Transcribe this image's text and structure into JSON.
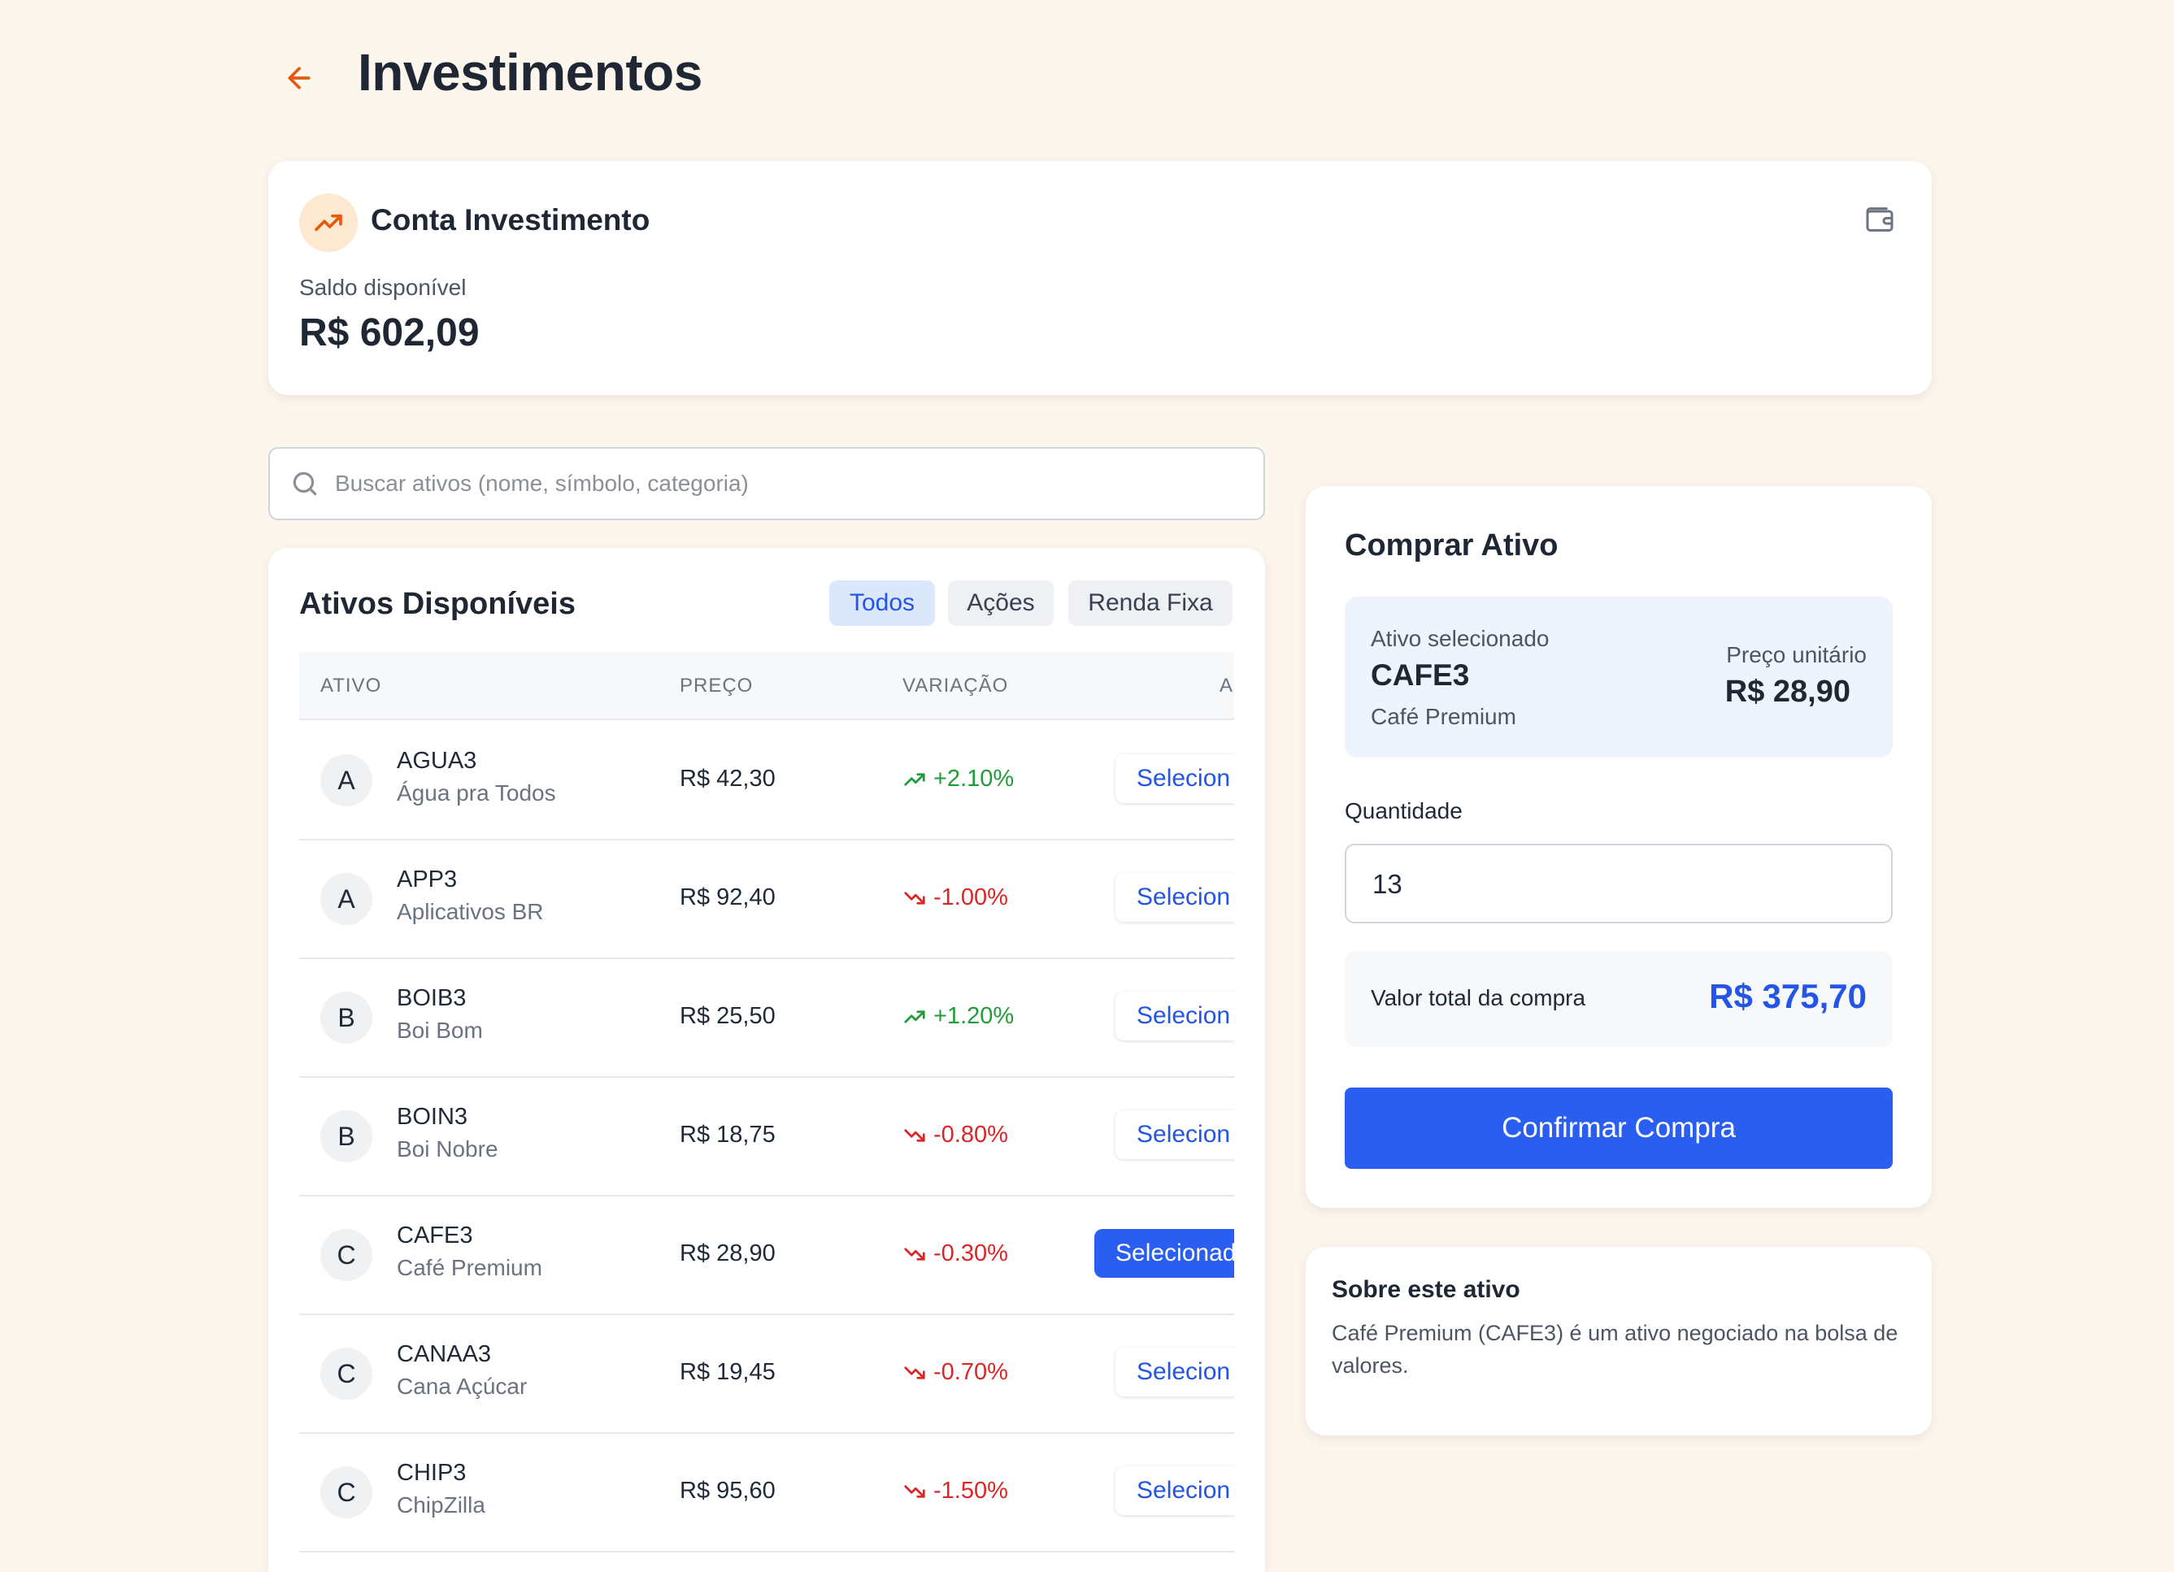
{
  "header": {
    "title": "Investimentos",
    "back_icon": "arrow-left-icon"
  },
  "colors": {
    "accent": "#e8590c",
    "primary": "#2a5ef0",
    "up": "#1f9d3a",
    "down": "#dc2626",
    "background": "#fdf6ec"
  },
  "account": {
    "title": "Conta Investimento",
    "icon": "trending-up-icon",
    "wallet_icon": "wallet-icon",
    "balance_label": "Saldo disponível",
    "balance": "R$ 602,09"
  },
  "search": {
    "placeholder": "Buscar ativos (nome, símbolo, categoria)",
    "value": ""
  },
  "assets": {
    "title": "Ativos Disponíveis",
    "filters": [
      "Todos",
      "Ações",
      "Renda Fixa"
    ],
    "active_filter": "Todos",
    "columns": [
      "ATIVO",
      "PREÇO",
      "VARIAÇÃO",
      "A"
    ],
    "rows": [
      {
        "initial": "A",
        "symbol": "AGUA3",
        "name": "Água pra Todos",
        "price": "R$ 42,30",
        "change": "+2.10%",
        "direction": "up",
        "action": "Selecion"
      },
      {
        "initial": "A",
        "symbol": "APP3",
        "name": "Aplicativos BR",
        "price": "R$ 92,40",
        "change": "-1.00%",
        "direction": "down",
        "action": "Selecion"
      },
      {
        "initial": "B",
        "symbol": "BOIB3",
        "name": "Boi Bom",
        "price": "R$ 25,50",
        "change": "+1.20%",
        "direction": "up",
        "action": "Selecion"
      },
      {
        "initial": "B",
        "symbol": "BOIN3",
        "name": "Boi Nobre",
        "price": "R$ 18,75",
        "change": "-0.80%",
        "direction": "down",
        "action": "Selecion"
      },
      {
        "initial": "C",
        "symbol": "CAFE3",
        "name": "Café Premium",
        "price": "R$ 28,90",
        "change": "-0.30%",
        "direction": "down",
        "action": "Selecionad",
        "selected": true
      },
      {
        "initial": "C",
        "symbol": "CANAA3",
        "name": "Cana Açúcar",
        "price": "R$ 19,45",
        "change": "-0.70%",
        "direction": "down",
        "action": "Selecion"
      },
      {
        "initial": "C",
        "symbol": "CHIP3",
        "name": "ChipZilla",
        "price": "R$ 95,60",
        "change": "-1.50%",
        "direction": "down",
        "action": "Selecion"
      }
    ]
  },
  "buy": {
    "title": "Comprar Ativo",
    "selected_label": "Ativo selecionado",
    "selected_symbol": "CAFE3",
    "selected_name": "Café Premium",
    "unit_price_label": "Preço unitário",
    "unit_price": "R$ 28,90",
    "quantity_label": "Quantidade",
    "quantity": "13",
    "total_label": "Valor total da compra",
    "total": "R$ 375,70",
    "confirm_label": "Confirmar Compra"
  },
  "about": {
    "title": "Sobre este ativo",
    "text": "Café Premium (CAFE3) é um ativo negociado na bolsa de valores."
  }
}
